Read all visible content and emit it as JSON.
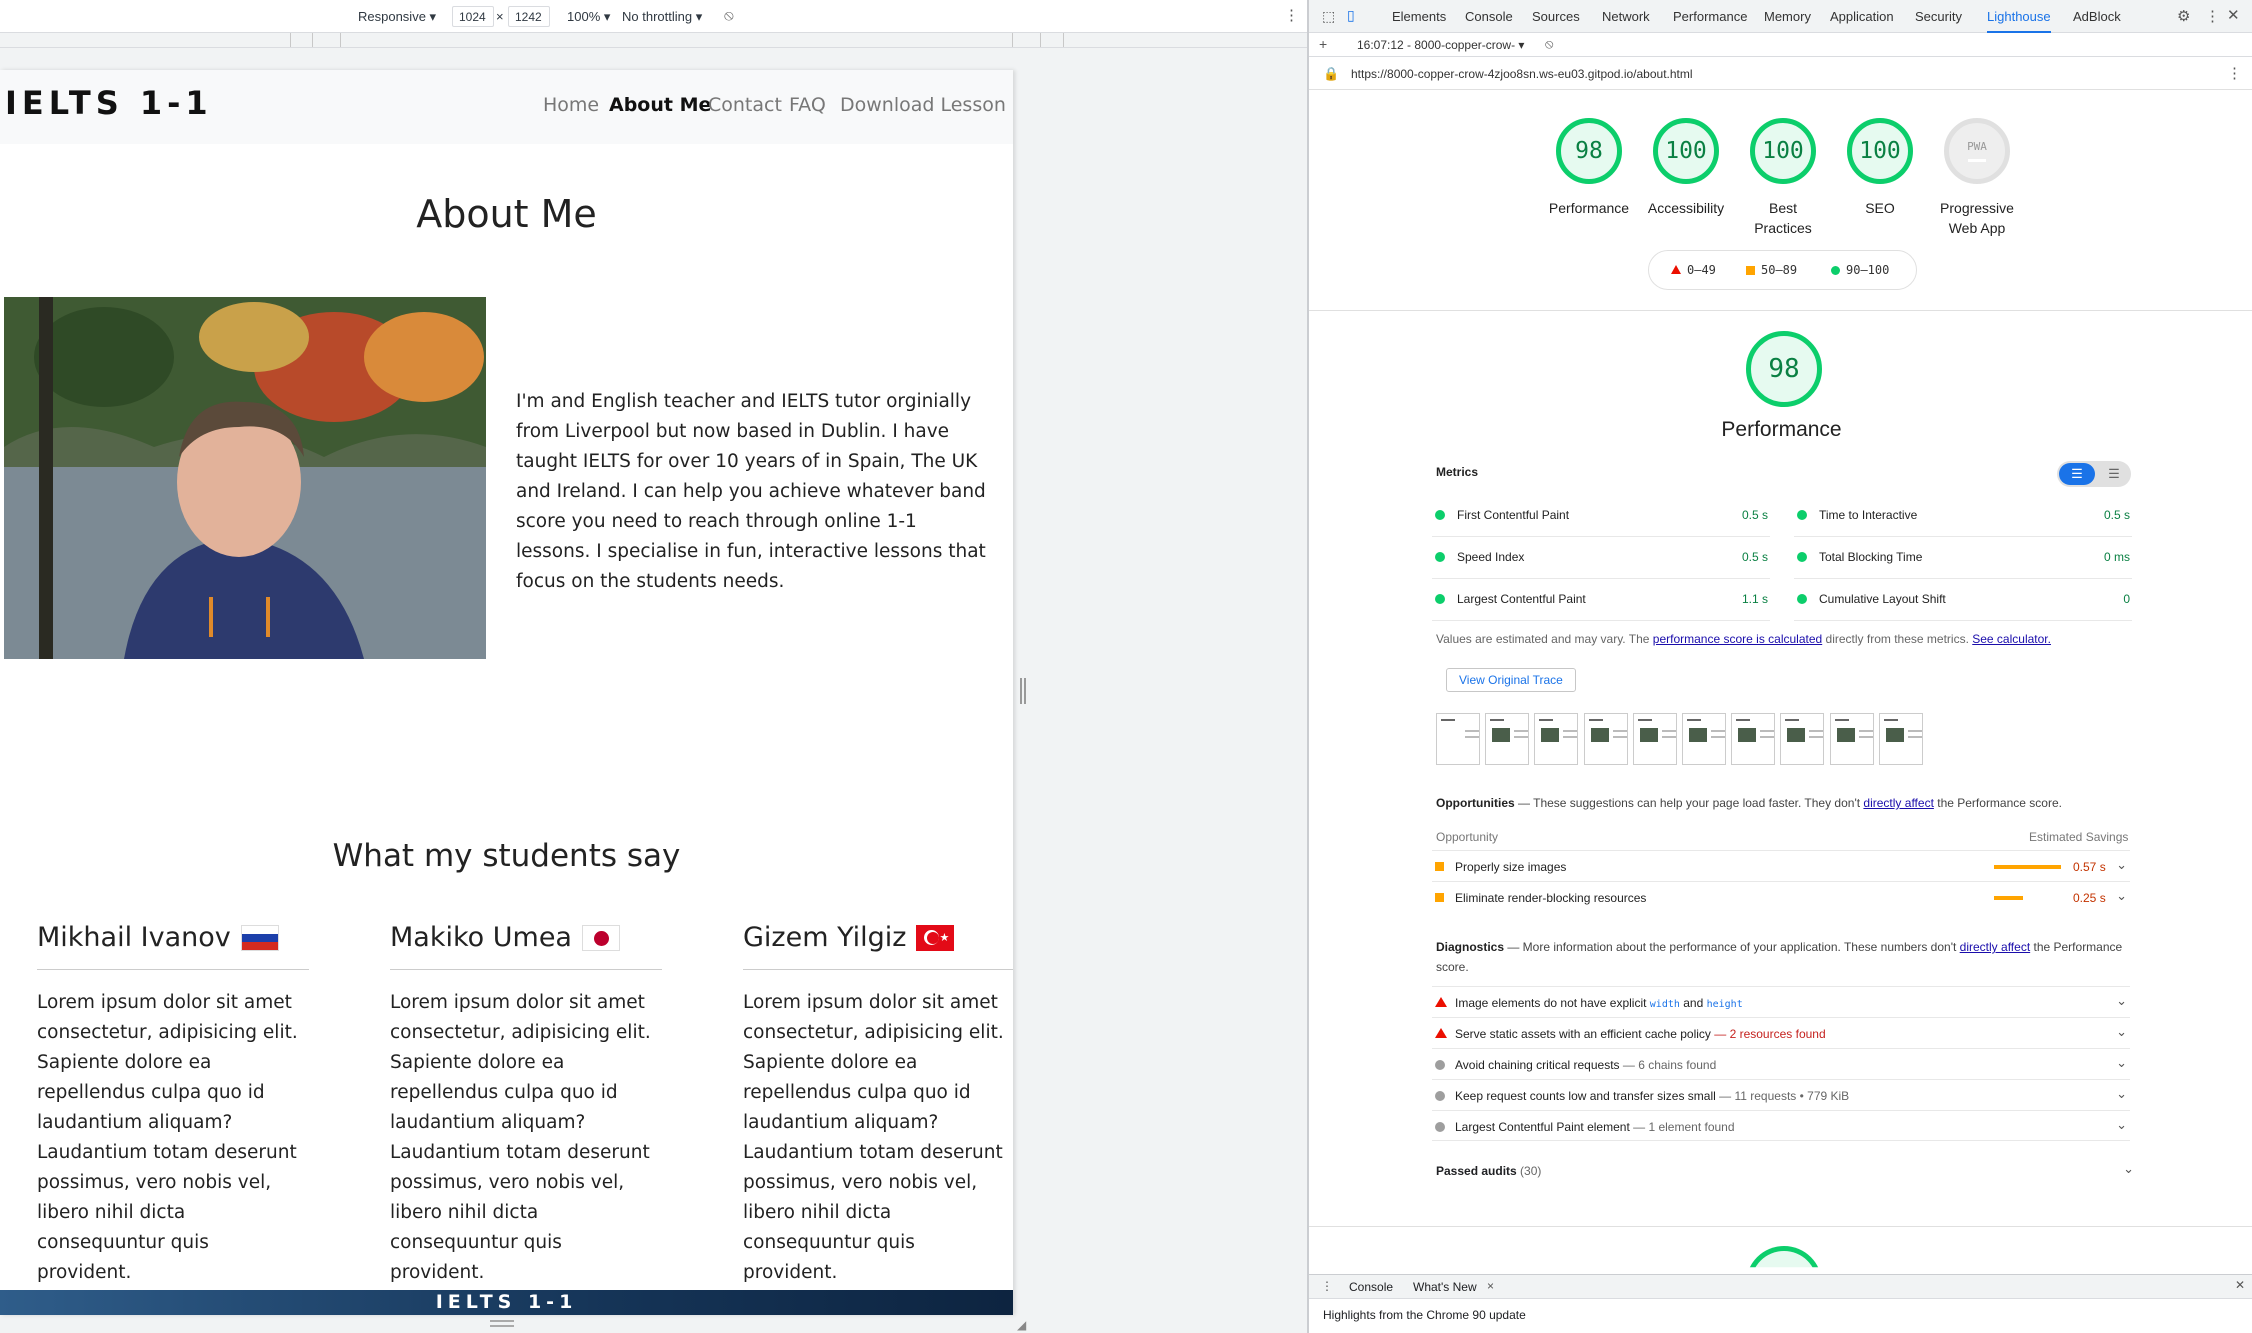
{
  "device_toolbar": {
    "device": "Responsive ▾",
    "width": "1024",
    "times": "×",
    "height": "1242",
    "zoom": "100% ▾",
    "throttle": "No throttling ▾"
  },
  "site": {
    "brand": "IELTS 1-1",
    "nav": [
      "Home",
      "About Me",
      "Contact",
      "FAQ",
      "Download Lesson"
    ],
    "about_title": "About Me",
    "bio": "I'm and English teacher and IELTS tutor orginially from Liverpool but now based in Dublin. I have taught IELTS for over 10 years of in Spain, The UK and Ireland. I can help you achieve whatever band score you need to reach through online 1-1 lessons. I specialise in fun, interactive lessons that focus on the students needs.",
    "students_title": "What my students say",
    "testimonials": [
      {
        "name": "Mikhail Ivanov",
        "flag": "russia-flag-icon",
        "text": "Lorem ipsum dolor sit amet consectetur, adipisicing elit. Sapiente dolore ea repellendus culpa quo id laudantium aliquam? Laudantium totam deserunt possimus, vero nobis vel, libero nihil dicta consequuntur quis provident."
      },
      {
        "name": "Makiko Umea",
        "flag": "japan-flag-icon",
        "text": "Lorem ipsum dolor sit amet consectetur, adipisicing elit. Sapiente dolore ea repellendus culpa quo id laudantium aliquam? Laudantium totam deserunt possimus, vero nobis vel, libero nihil dicta consequuntur quis provident."
      },
      {
        "name": "Gizem Yilgiz",
        "flag": "turkey-flag-icon",
        "text": "Lorem ipsum dolor sit amet consectetur, adipisicing elit. Sapiente dolore ea repellendus culpa quo id laudantium aliquam? Laudantium totam deserunt possimus, vero nobis vel, libero nihil dicta consequuntur quis provident."
      }
    ],
    "footer_brand": "IELTS 1-1"
  },
  "devtools": {
    "tabs": [
      "Elements",
      "Console",
      "Sources",
      "Network",
      "Performance",
      "Memory",
      "Application",
      "Security",
      "Lighthouse",
      "AdBlock"
    ],
    "active_tab": "Lighthouse",
    "report_select": "16:07:12 - 8000-copper-crow- ▾",
    "url": "https://8000-copper-crow-4zjoo8sn.ws-eu03.gitpod.io/about.html",
    "gauges": [
      {
        "score": "98",
        "label": "Performance"
      },
      {
        "score": "100",
        "label": "Accessibility"
      },
      {
        "score": "100",
        "label": "Best Practices"
      },
      {
        "score": "100",
        "label": "SEO"
      },
      {
        "score": "PWA",
        "label": "Progressive Web App"
      }
    ],
    "legend": {
      "fail": "0–49",
      "average": "50–89",
      "pass": "90–100"
    },
    "perf_score": "98",
    "perf_title": "Performance",
    "metrics_label": "Metrics",
    "metrics": [
      {
        "name": "First Contentful Paint",
        "value": "0.5 s"
      },
      {
        "name": "Time to Interactive",
        "value": "0.5 s"
      },
      {
        "name": "Speed Index",
        "value": "0.5 s"
      },
      {
        "name": "Total Blocking Time",
        "value": "0 ms"
      },
      {
        "name": "Largest Contentful Paint",
        "value": "1.1 s"
      },
      {
        "name": "Cumulative Layout Shift",
        "value": "0"
      }
    ],
    "estimate_note_1": "Values are estimated and may vary. The ",
    "estimate_link": "performance score is calculated",
    "estimate_note_2": " directly from these metrics. ",
    "calculator_link": "See calculator.",
    "view_trace": "View Original Trace",
    "opportunities_title": "Opportunities",
    "opportunities_desc": " — These suggestions can help your page load faster. They don't ",
    "directly_affect": "directly affect",
    "opportunities_desc2": " the Performance score.",
    "opp_col_left": "Opportunity",
    "opp_col_right": "Estimated Savings",
    "opportunities": [
      {
        "name": "Properly size images",
        "saving": "0.57 s",
        "bar": 0.95
      },
      {
        "name": "Eliminate render-blocking resources",
        "saving": "0.25 s",
        "bar": 0.42
      }
    ],
    "diagnostics_title": "Diagnostics",
    "diagnostics_desc": " — More information about the performance of your application. These numbers don't ",
    "diagnostics_desc2": " the Performance score.",
    "diag_img_text": "Image elements do not have explicit ",
    "diag_img_code1": "width",
    "diag_img_and": " and ",
    "diag_img_code2": "height",
    "diag_cache": "Serve static assets with an efficient cache policy",
    "diag_cache_detail": " — 2 resources found",
    "diag_chain": "Avoid chaining critical requests",
    "diag_chain_detail": " — 6 chains found",
    "diag_requests": "Keep request counts low and transfer sizes small",
    "diag_requests_detail": " — 11 requests • 779 KiB",
    "diag_lcp": "Largest Contentful Paint element",
    "diag_lcp_detail": " — 1 element found",
    "passed": "Passed audits",
    "passed_count": " (30)",
    "drawer_tabs": [
      "Console",
      "What's New"
    ],
    "drawer_text": "Highlights from the Chrome 90 update"
  },
  "colors": {
    "pass": "#0cce6b",
    "average": "#ffa400",
    "fail": "#eb0f00",
    "accent": "#1a73e8"
  }
}
